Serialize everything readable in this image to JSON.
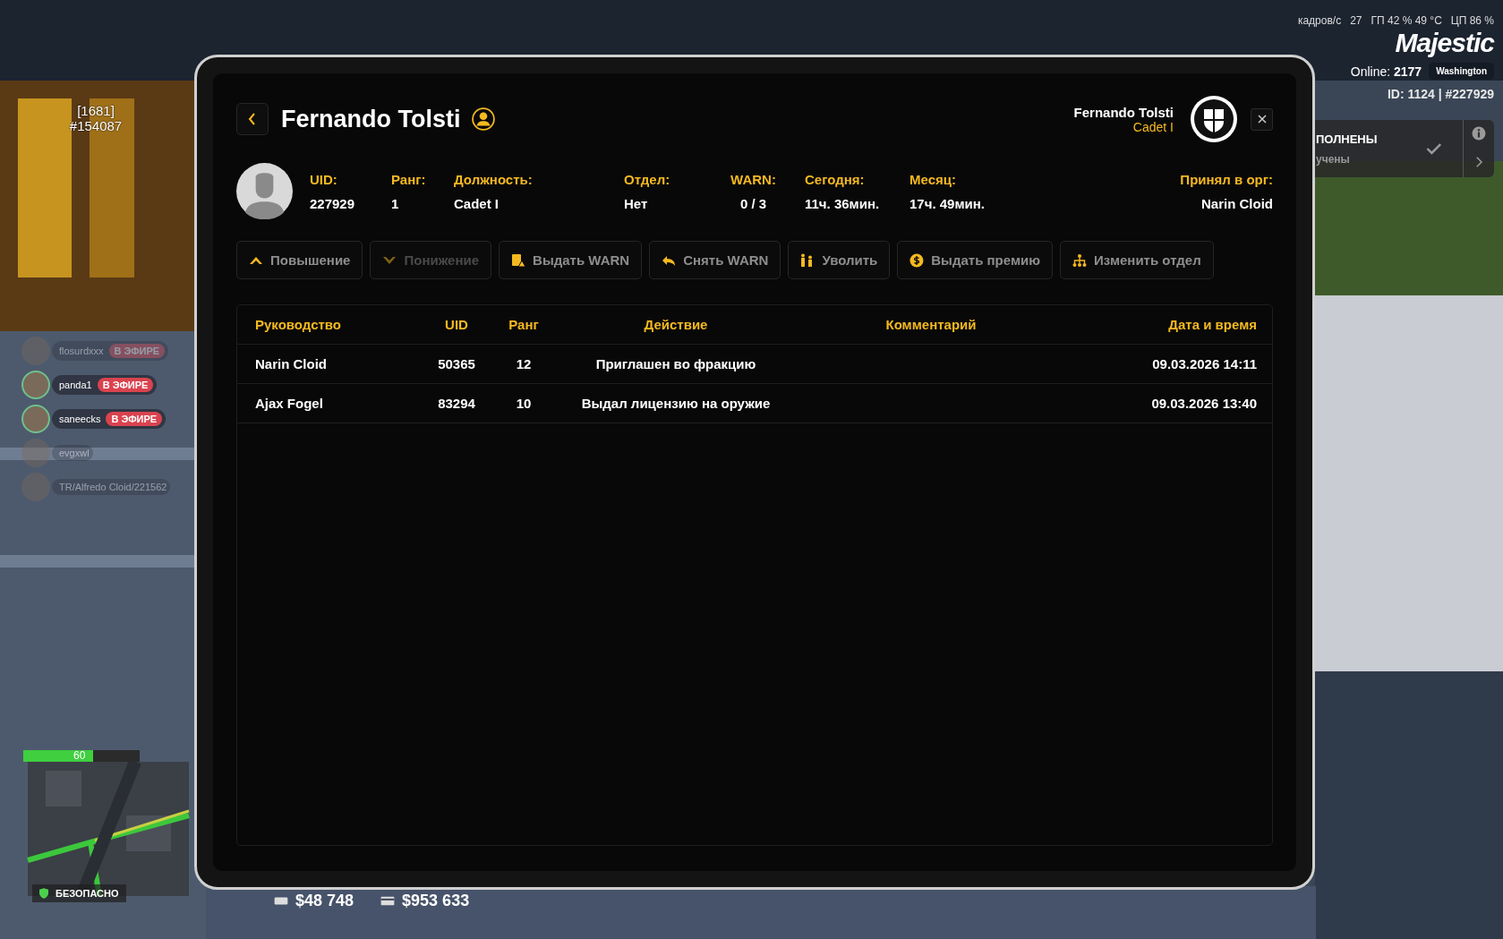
{
  "hud": {
    "fps_label": "кадров/с",
    "fps": "27",
    "gpu": "ГП 42 % 49 °C",
    "cpu": "ЦП 86 %",
    "logo": "Majestic",
    "online_label": "Online:",
    "online": "2177",
    "server": "Washington",
    "id_line": "ID: 1124 | #227929"
  },
  "notice": {
    "title": "ПОЛНЕНЫ",
    "subtitle": "учены"
  },
  "nametag": {
    "id": "[1681]",
    "uid": "#154087"
  },
  "voice": [
    {
      "name": "flosurdxxx",
      "badge": "В ЭФИРЕ",
      "active": false
    },
    {
      "name": "panda1",
      "badge": "В ЭФИРЕ",
      "active": true
    },
    {
      "name": "saneecks",
      "badge": "В ЭФИРЕ",
      "active": true
    },
    {
      "name": "evgxwl",
      "active": false
    },
    {
      "name": "TR/Alfredo Cloid/221562",
      "active": false
    }
  ],
  "health": {
    "level": 0.6,
    "reading": "60"
  },
  "zone": "БЕЗОПАСНО",
  "money": {
    "cash": "$48 748",
    "bank": "$953 633"
  },
  "tablet": {
    "title": "Fernando Tolsti",
    "user": {
      "name": "Fernando Tolsti",
      "rank": "Cadet I"
    },
    "stats": [
      {
        "label": "UID:",
        "value": "227929"
      },
      {
        "label": "Ранг:",
        "value": "1"
      },
      {
        "label": "Должность:",
        "value": "Cadet I"
      },
      {
        "label": "Отдел:",
        "value": "Нет"
      },
      {
        "label": "WARN:",
        "value": "0 / 3"
      },
      {
        "label": "Сегодня:",
        "value": "11ч. 36мин."
      },
      {
        "label": "Месяц:",
        "value": "17ч. 49мин."
      },
      {
        "label": "Принял в орг:",
        "value": "Narin Cloid"
      }
    ],
    "actions": [
      {
        "label": "Повышение",
        "kind": "up",
        "disabled": false
      },
      {
        "label": "Понижение",
        "kind": "down",
        "disabled": true
      },
      {
        "label": "Выдать WARN",
        "kind": "warn",
        "disabled": false
      },
      {
        "label": "Снять WARN",
        "kind": "undo",
        "disabled": false
      },
      {
        "label": "Уволить",
        "kind": "fire",
        "disabled": false
      },
      {
        "label": "Выдать премию",
        "kind": "money",
        "disabled": false
      },
      {
        "label": "Изменить отдел",
        "kind": "tree",
        "disabled": false
      }
    ],
    "table": {
      "columns": [
        "Руководство",
        "UID",
        "Ранг",
        "Действие",
        "Комментарий",
        "Дата и время"
      ],
      "rows": [
        [
          "Narin Cloid",
          "50365",
          "12",
          "Приглашен во фракцию",
          "",
          "09.03.2026 14:11"
        ],
        [
          "Ajax Fogel",
          "83294",
          "10",
          "Выдал лицензию на оружие",
          "",
          "09.03.2026 13:40"
        ]
      ]
    }
  }
}
